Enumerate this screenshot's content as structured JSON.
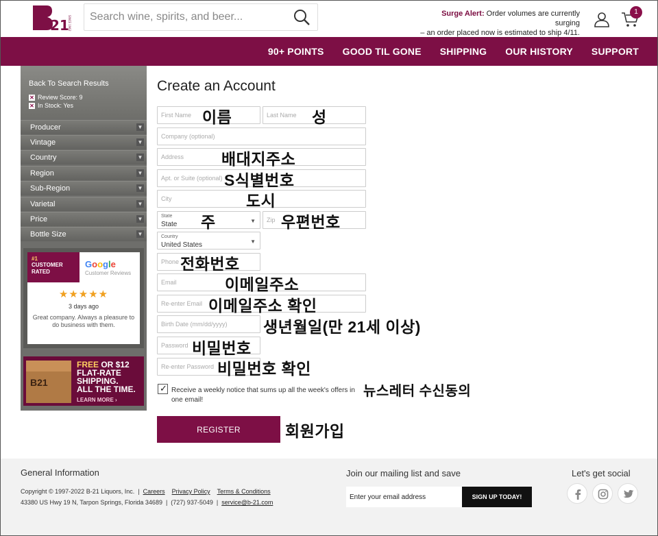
{
  "header": {
    "logo_text": "B21",
    "logo_since": "SINCE 1962",
    "search_placeholder": "Search wine, spirits, and beer...",
    "surge_label": "Surge Alert:",
    "surge_line1": " Order volumes are currently surging",
    "surge_line2": "– an order placed now is estimated to ship 4/11.",
    "cart_count": "1"
  },
  "nav": [
    "90+ POINTS",
    "GOOD TIL GONE",
    "SHIPPING",
    "OUR HISTORY",
    "SUPPORT"
  ],
  "sidebar": {
    "back": "Back To Search Results",
    "filters": [
      "Review Score: 9",
      "In Stock: Yes"
    ],
    "items": [
      "Producer",
      "Vintage",
      "Country",
      "Region",
      "Sub-Region",
      "Varietal",
      "Price",
      "Bottle Size"
    ],
    "rated": {
      "rank": "#1",
      "label1": "CUSTOMER",
      "label2": "RATED",
      "google": "Google",
      "google_sub": "Customer Reviews",
      "stars": "★★★★★",
      "days": "3 days ago",
      "quote": "Great company. Always a pleasure to do business with them."
    },
    "shipping_ad": {
      "line1_hl": "FREE",
      "line1_rest": " OR $12",
      "line2": "FLAT-RATE",
      "line3": "SHIPPING.",
      "line4": "ALL THE TIME.",
      "cta": "LEARN MORE ›",
      "box_label": "B21"
    }
  },
  "form": {
    "title": "Create an Account",
    "first_name": "First Name",
    "last_name": "Last Name",
    "company": "Company (optional)",
    "address": "Address",
    "apt": "Apt. or Suite (optional)",
    "city": "City",
    "state_label": "State",
    "state_value": "State",
    "zip": "Zip",
    "country_label": "Country",
    "country_value": "United States",
    "phone": "Phone",
    "email": "Email",
    "reenter_email": "Re-enter Email",
    "birth": "Birth Date (mm/dd/yyyy)",
    "password": "Password",
    "reenter_password": "Re-enter Password",
    "newsletter": "Receive a weekly notice that sums up all the week's offers in one email!",
    "register": "REGISTER"
  },
  "annotations": {
    "first_name": "이름",
    "last_name": "성",
    "address": "배대지주소",
    "apt": "S식별번호",
    "city": "도시",
    "state": "주",
    "zip": "우편번호",
    "phone": "전화번호",
    "email": "이메일주소",
    "reenter_email": "이메일주소 확인",
    "birth": "생년월일(만 21세 이상)",
    "password": "비밀번호",
    "reenter_password": "비밀번호 확인",
    "newsletter": "뉴스레터 수신동의",
    "register": "회원가입"
  },
  "footer": {
    "general": "General Information",
    "copyright": "Copyright © 1997-2022 B-21 Liquors, Inc.",
    "careers": "Careers",
    "privacy": "Privacy Policy",
    "terms": "Terms & Conditions",
    "address": "43380 US Hwy 19 N, Tarpon Springs, Florida 34689",
    "phone": "(727) 937-5049",
    "email": "service@b-21.com",
    "mailing": "Join our mailing list and save",
    "email_placeholder": "Enter your email address",
    "signup": "SIGN UP TODAY!",
    "social": "Let's get social"
  },
  "colors": {
    "brand": "#7d0f45",
    "footer_bg": "#f2f2f2",
    "sidebar_bg": "#6e6e6b"
  }
}
